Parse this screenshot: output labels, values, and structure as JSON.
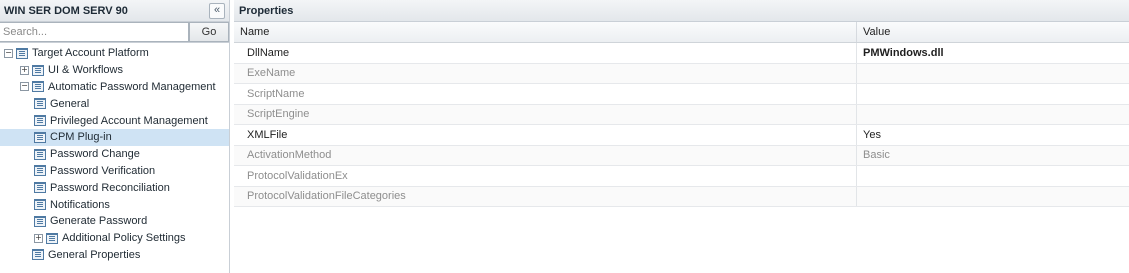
{
  "left_panel": {
    "title": "WIN SER DOM SERV 90",
    "collapse_glyph": "«",
    "search": {
      "placeholder": "Search...",
      "value": "",
      "go_label": "Go"
    },
    "tree": [
      {
        "label": "Target Account Platform",
        "expander": "−",
        "level": 0
      },
      {
        "label": "UI & Workflows",
        "expander": "+",
        "level": 1
      },
      {
        "label": "Automatic Password Management",
        "expander": "−",
        "level": 1
      },
      {
        "label": "General",
        "level": 2
      },
      {
        "label": "Privileged Account Management",
        "level": 2
      },
      {
        "label": "CPM Plug-in",
        "level": 2,
        "selected": true
      },
      {
        "label": "Password Change",
        "level": 2
      },
      {
        "label": "Password Verification",
        "level": 2
      },
      {
        "label": "Password Reconciliation",
        "level": 2
      },
      {
        "label": "Notifications",
        "level": 2
      },
      {
        "label": "Generate Password",
        "level": 2
      },
      {
        "label": "Additional Policy Settings",
        "expander": "+",
        "level": 2
      },
      {
        "label": "General Properties",
        "level": 1
      }
    ]
  },
  "properties": {
    "title": "Properties",
    "columns": {
      "name": "Name",
      "value": "Value"
    },
    "rows": [
      {
        "name": "DllName",
        "value": "PMWindows.dll",
        "enabled": true,
        "bold": true
      },
      {
        "name": "ExeName",
        "value": "",
        "enabled": false
      },
      {
        "name": "ScriptName",
        "value": "",
        "enabled": false
      },
      {
        "name": "ScriptEngine",
        "value": "",
        "enabled": false
      },
      {
        "name": "XMLFile",
        "value": "Yes",
        "enabled": true
      },
      {
        "name": "ActivationMethod",
        "value": "Basic",
        "enabled": false
      },
      {
        "name": "ProtocolValidationEx",
        "value": "",
        "enabled": false
      },
      {
        "name": "ProtocolValidationFileCategories",
        "value": "",
        "enabled": false
      }
    ]
  },
  "colors": {
    "selected_row": "#cfe3f4",
    "accent_icon": "#4f7aa3",
    "disabled_text": "#8e8e8e"
  }
}
